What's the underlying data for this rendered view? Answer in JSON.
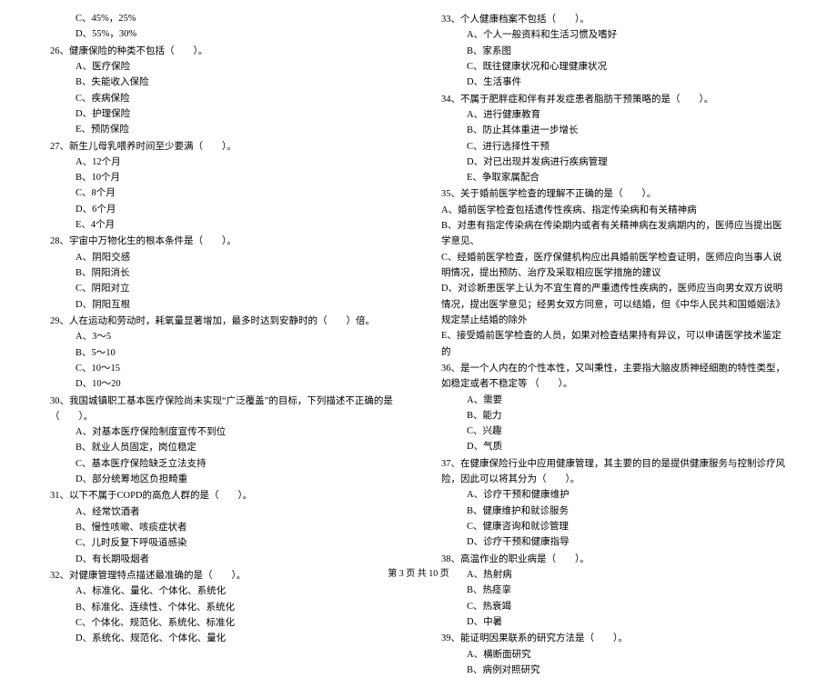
{
  "left": {
    "pre_opts": [
      "C、45%，25%",
      "D、55%，30%"
    ],
    "questions": [
      {
        "num": "26",
        "text": "、健康保险的种类不包括（　　）。",
        "opts": [
          "A、医疗保险",
          "B、失能收入保险",
          "C、疾病保险",
          "D、护理保险",
          "E、预防保险"
        ]
      },
      {
        "num": "27",
        "text": "、新生儿母乳喂养时间至少要满（　　）。",
        "opts": [
          "A、12个月",
          "B、10个月",
          "C、8个月",
          "D、6个月",
          "E、4个月"
        ]
      },
      {
        "num": "28",
        "text": "、宇宙中万物化生的根本条件是（　　）。",
        "opts": [
          "A、阴阳交感",
          "B、阴阳消长",
          "C、阴阳对立",
          "D、阴阳互根"
        ]
      },
      {
        "num": "29",
        "text": "、人在运动和劳动时，耗氧量显著增加，最多时达到安静时的（　　）倍。",
        "opts": [
          "A、3～5",
          "B、5～10",
          "C、10～15",
          "D、10～20"
        ]
      },
      {
        "num": "30",
        "text": "、我国城镇职工基本医疗保险尚未实现“广泛覆盖”的目标，下列描述不正确的是（　　）。",
        "opts": [
          "A、对基本医疗保险制度宣传不到位",
          "B、就业人员固定，岗位稳定",
          "C、基本医疗保险缺乏立法支持",
          "D、部分统筹地区负担畸重"
        ]
      },
      {
        "num": "31",
        "text": "、以下不属于COPD的高危人群的是（　　）。",
        "opts": [
          "A、经常饮酒者",
          "B、慢性咳嗽、咳痰症状者",
          "C、儿时反复下呼吸道感染",
          "D、有长期吸烟者"
        ]
      },
      {
        "num": "32",
        "text": "、对健康管理特点描述最准确的是（　　）。",
        "opts": [
          "A、标准化、量化、个体化、系统化",
          "B、标准化、连续性、个体化、系统化",
          "C、个体化、规范化、系统化、标准化",
          "D、系统化、规范化、个体化、量化"
        ]
      }
    ]
  },
  "right": {
    "questions": [
      {
        "num": "33",
        "text": "、个人健康档案不包括（　　）。",
        "opts": [
          "A、个人一般资料和生活习惯及嗜好",
          "B、家系图",
          "C、既往健康状况和心理健康状况",
          "D、生活事件"
        ]
      },
      {
        "num": "34",
        "text": "、不属于肥胖症和伴有并发症患者脂肪干预策略的是（　　）。",
        "opts": [
          "A、进行健康教育",
          "B、防止其体重进一步增长",
          "C、进行选择性干预",
          "D、对已出现并发病进行疾病管理",
          "E、争取家属配合"
        ]
      },
      {
        "num": "35",
        "text": "、关于婚前医学检查的理解不正确的是（　　）。",
        "long_opts": [
          "A、婚前医学检查包括遗传性疾病、指定传染病和有关精神病",
          "B、对患有指定传染病在传染期内或者有关精神病在发病期内的，医师应当提出医学意见、",
          "C、经婚前医学检查，医疗保健机构应出具婚前医学检查证明，医师应向当事人说明情况，提出预防、治疗及采取相应医学措施的建议",
          "D、对诊断患医学上认为不宜生育的严重遗传性疾病的，医师应当向男女双方说明情况，提出医学意见；经男女双方同意，可以结婚，但《中华人民共和国婚姻法》规定禁止结婚的除外",
          "E、接受婚前医学检查的人员，如果对检查结果持有异议，可以申请医学技术鉴定的"
        ]
      },
      {
        "num": "36",
        "text": "、是一个人内在的个性本性，又叫秉性，主要指大脑皮质神经细胞的特性类型，如稳定或者不稳定等 （　　）。",
        "opts": [
          "A、需要",
          "B、能力",
          "C、兴趣",
          "D、气质"
        ],
        "inline": true
      },
      {
        "num": "37",
        "text": "、在健康保险行业中应用健康管理，其主要的目的是提供健康服务与控制诊疗风险，因此可以将其分为（　　）。",
        "opts": [
          "A、诊疗干预和健康维护",
          "B、健康维护和就诊服务",
          "C、健康咨询和就诊管理",
          "D、诊疗干预和健康指导"
        ],
        "inline": true
      },
      {
        "num": "38",
        "text": "、高温作业的职业病是（　　）。",
        "opts": [
          "A、热射病",
          "B、热痉挛",
          "C、热衰竭",
          "D、中暑"
        ]
      },
      {
        "num": "39",
        "text": "、能证明因果联系的研究方法是（　　）。",
        "opts": [
          "A、横断面研究",
          "B、病例对照研究"
        ]
      }
    ]
  },
  "footer": "第 3 页 共 10 页"
}
